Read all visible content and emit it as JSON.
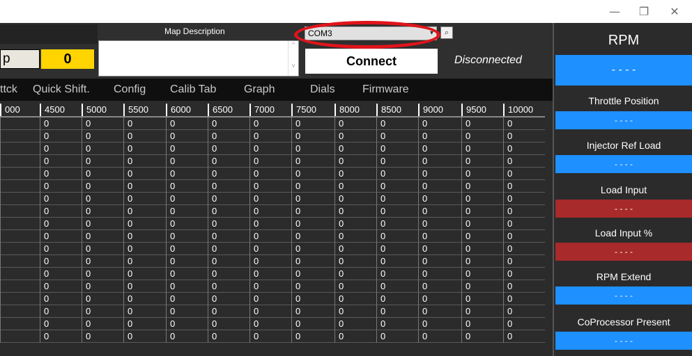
{
  "window": {
    "min_icon": "—",
    "max_icon": "❐",
    "close_icon": "✕"
  },
  "header": {
    "p_label": "p",
    "counter": "0",
    "map_description_label": "Map Description",
    "com_port": "COM3",
    "connect_label": "Connect",
    "status": "Disconnected"
  },
  "tabs": [
    "ttck",
    "Quick Shift.",
    "Config",
    "Calib Tab",
    "Graph",
    "Dials",
    "Firmware"
  ],
  "grid": {
    "columns": [
      "000",
      "4500",
      "5000",
      "5500",
      "6000",
      "6500",
      "7000",
      "7500",
      "8000",
      "8500",
      "9000",
      "9500",
      "10000"
    ],
    "cell_value": "0",
    "row_count": 18
  },
  "gauges": [
    {
      "label": "RPM",
      "value": "- - - -",
      "color": "#1e90ff"
    },
    {
      "label": "Throttle Position",
      "value": "- - - -",
      "color": "#1e90ff"
    },
    {
      "label": "Injector Ref Load",
      "value": "- - - -",
      "color": "#1e90ff"
    },
    {
      "label": "Load Input",
      "value": "- - - -",
      "color": "#a82a2a"
    },
    {
      "label": "Load Input %",
      "value": "- - - -",
      "color": "#a82a2a"
    },
    {
      "label": "RPM Extend",
      "value": "- - - -",
      "color": "#1e90ff"
    },
    {
      "label": "CoProcessor Present",
      "value": "- - - -",
      "color": "#1e90ff"
    }
  ],
  "colors": {
    "accent_blue": "#1e90ff",
    "accent_red": "#a82a2a",
    "highlight_ring": "#e0141b",
    "counter_bg": "#ffd400"
  }
}
